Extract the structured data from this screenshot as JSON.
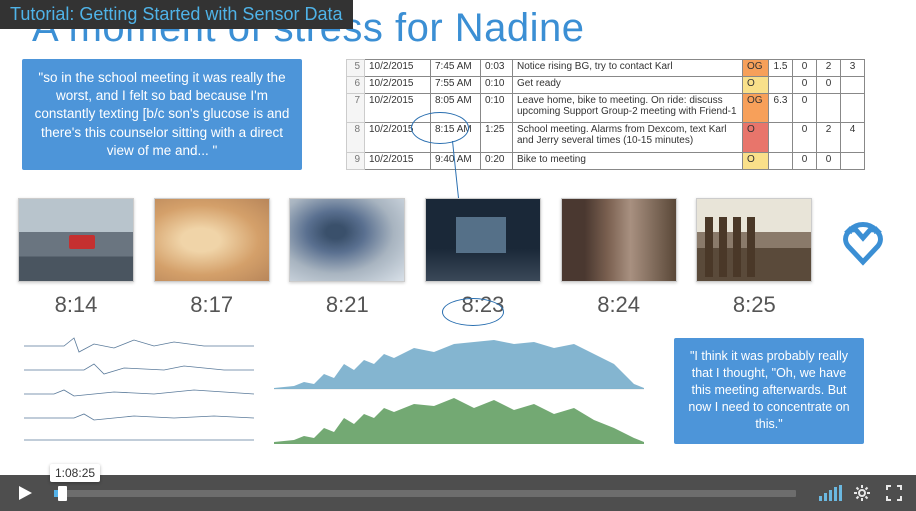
{
  "overlay_title": "Tutorial: Getting Started with Sensor Data",
  "slide": {
    "title": "A moment of stress for Nadine",
    "quote1": "\"so in the school meeting it was really the worst, and I felt so bad because I'm constantly texting [b/c son's glucose is and there's this counselor sitting with a direct view of me and... \"",
    "quote2": "\"I think it was probably really that I thought, \"Oh, we have this meeting afterwards. But now I need to concentrate on this.\"",
    "photo_times": [
      "8:14",
      "8:17",
      "8:21",
      "8:23",
      "8:24",
      "8:25"
    ]
  },
  "table": {
    "rows": [
      {
        "n": "5",
        "date": "10/2/2015",
        "time": "7:45 AM",
        "dur": "0:03",
        "desc": "Notice rising BG, try to contact Karl",
        "tag": "OG",
        "tag_bg": "bg-orange",
        "v1": "1.5",
        "v2": "0",
        "v3": "2",
        "v4": "3"
      },
      {
        "n": "6",
        "date": "10/2/2015",
        "time": "7:55 AM",
        "dur": "0:10",
        "desc": "Get ready",
        "tag": "O",
        "tag_bg": "bg-yellow",
        "v1": "",
        "v2": "0",
        "v3": "0",
        "v4": ""
      },
      {
        "n": "7",
        "date": "10/2/2015",
        "time": "8:05 AM",
        "dur": "0:10",
        "desc": "Leave home, bike to meeting. On ride: discuss upcoming Support Group-2 meeting with Friend-1",
        "tag": "OG",
        "tag_bg": "bg-orange",
        "v1": "6.3",
        "v2": "0",
        "v3": "",
        "v4": ""
      },
      {
        "n": "8",
        "date": "10/2/2015",
        "time": "8:15 AM",
        "dur": "1:25",
        "desc": "School meeting. Alarms from Dexcom, text Karl and Jerry several times (10-15 minutes)",
        "tag": "O",
        "tag_bg": "bg-red",
        "v1": "",
        "v2": "0",
        "v3": "2",
        "v4": "4"
      },
      {
        "n": "9",
        "date": "10/2/2015",
        "time": "9:40 AM",
        "dur": "0:20",
        "desc": "Bike to meeting",
        "tag": "O",
        "tag_bg": "bg-yellow",
        "v1": "",
        "v2": "0",
        "v3": "0",
        "v4": ""
      }
    ]
  },
  "player": {
    "tooltip": "1:08:25"
  }
}
